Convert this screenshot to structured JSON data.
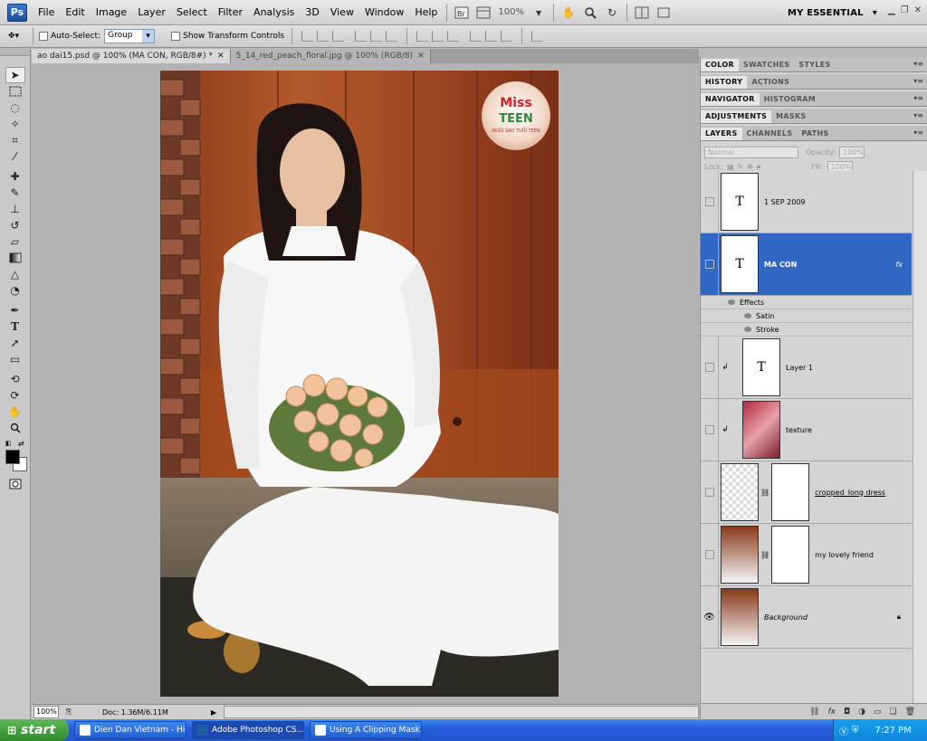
{
  "menubar": {
    "logo": "Ps",
    "items": [
      "File",
      "Edit",
      "Image",
      "Layer",
      "Select",
      "Filter",
      "Analysis",
      "3D",
      "View",
      "Window",
      "Help"
    ],
    "zoom": "100%",
    "workspace": "MY ESSENTIAL"
  },
  "options": {
    "auto_select_label": "Auto-Select:",
    "auto_select_value": "Group",
    "show_transform_label": "Show Transform Controls"
  },
  "tabs": [
    {
      "label": "ao dai15.psd @ 100% (MA CON, RGB/8#) *"
    },
    {
      "label": "5_14_red_peach_floral.jpg @ 100% (RGB/8)"
    }
  ],
  "status": {
    "zoom": "100%",
    "doc": "Doc: 1.36M/6.11M"
  },
  "canvas_logo": {
    "miss": "Miss",
    "teen": "TEEN",
    "sub": "NGÔI SAO TUỔI TEEN"
  },
  "panel_groups": [
    {
      "tabs": [
        "COLOR",
        "SWATCHES",
        "STYLES"
      ]
    },
    {
      "tabs": [
        "HISTORY",
        "ACTIONS"
      ]
    },
    {
      "tabs": [
        "NAVIGATOR",
        "HISTOGRAM"
      ]
    },
    {
      "tabs": [
        "ADJUSTMENTS",
        "MASKS"
      ]
    },
    {
      "tabs": [
        "LAYERS",
        "CHANNELS",
        "PATHS"
      ]
    }
  ],
  "layer_opts": {
    "blend": "Normal",
    "opacity_label": "Opacity:",
    "opacity": "100%",
    "lock_label": "Lock:",
    "fill_label": "Fill:",
    "fill": "100%"
  },
  "layers": [
    {
      "name": "1 SEP 2009",
      "thumb": "T"
    },
    {
      "name": "MA CON",
      "thumb": "T",
      "fx": "fx"
    },
    {
      "name": "Layer 1",
      "thumb": "T"
    },
    {
      "name": "texture",
      "thumb": ""
    },
    {
      "name": "cropped_long dress",
      "thumb": ""
    },
    {
      "name": "my lovely friend",
      "thumb": ""
    },
    {
      "name": "Background",
      "thumb": ""
    }
  ],
  "effects": {
    "header": "Effects",
    "items": [
      "Satin",
      "Stroke"
    ]
  },
  "taskbar": {
    "start": "start",
    "tasks": [
      "Dien Dan Vietnam - Hi...",
      "Adobe Photoshop CS...",
      "Using A Clipping Mask..."
    ],
    "clock": "7:27 PM"
  }
}
